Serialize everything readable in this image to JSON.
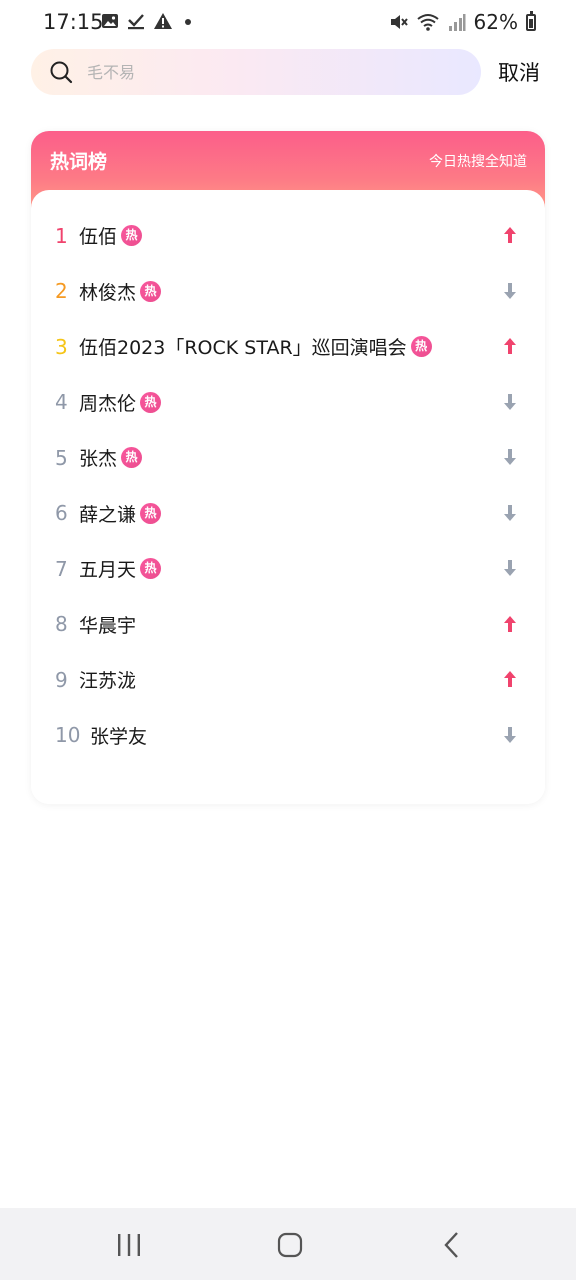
{
  "status_bar": {
    "time": "17:15",
    "battery": "62%",
    "left_icons": [
      "gallery-icon",
      "check-icon",
      "warning-icon",
      "dot-icon"
    ],
    "right_icons": [
      "mute-icon",
      "wifi-icon",
      "signal-icon",
      "battery-icon"
    ]
  },
  "search": {
    "placeholder": "毛不易",
    "value": "",
    "cancel_label": "取消"
  },
  "hot_list": {
    "title": "热词榜",
    "subtitle": "今日热搜全知道",
    "hot_label": "热",
    "colors": {
      "rank1": "#f0436d",
      "rank2": "#f59a23",
      "rank3": "#f5c518",
      "up": "#f0436d",
      "down": "#9aa3b1"
    },
    "items": [
      {
        "rank": "1",
        "text": "伍佰",
        "hot": true,
        "trend": "up"
      },
      {
        "rank": "2",
        "text": "林俊杰",
        "hot": true,
        "trend": "down"
      },
      {
        "rank": "3",
        "text": "伍佰2023「ROCK STAR」巡回演唱会",
        "hot": true,
        "trend": "up"
      },
      {
        "rank": "4",
        "text": "周杰伦",
        "hot": true,
        "trend": "down"
      },
      {
        "rank": "5",
        "text": "张杰",
        "hot": true,
        "trend": "down"
      },
      {
        "rank": "6",
        "text": "薛之谦",
        "hot": true,
        "trend": "down"
      },
      {
        "rank": "7",
        "text": "五月天",
        "hot": true,
        "trend": "down"
      },
      {
        "rank": "8",
        "text": "华晨宇",
        "hot": false,
        "trend": "up"
      },
      {
        "rank": "9",
        "text": "汪苏泷",
        "hot": false,
        "trend": "up"
      },
      {
        "rank": "10",
        "text": "张学友",
        "hot": false,
        "trend": "down"
      }
    ]
  },
  "nav_bar": {
    "buttons": [
      "recent-apps-icon",
      "home-icon",
      "back-icon"
    ]
  }
}
